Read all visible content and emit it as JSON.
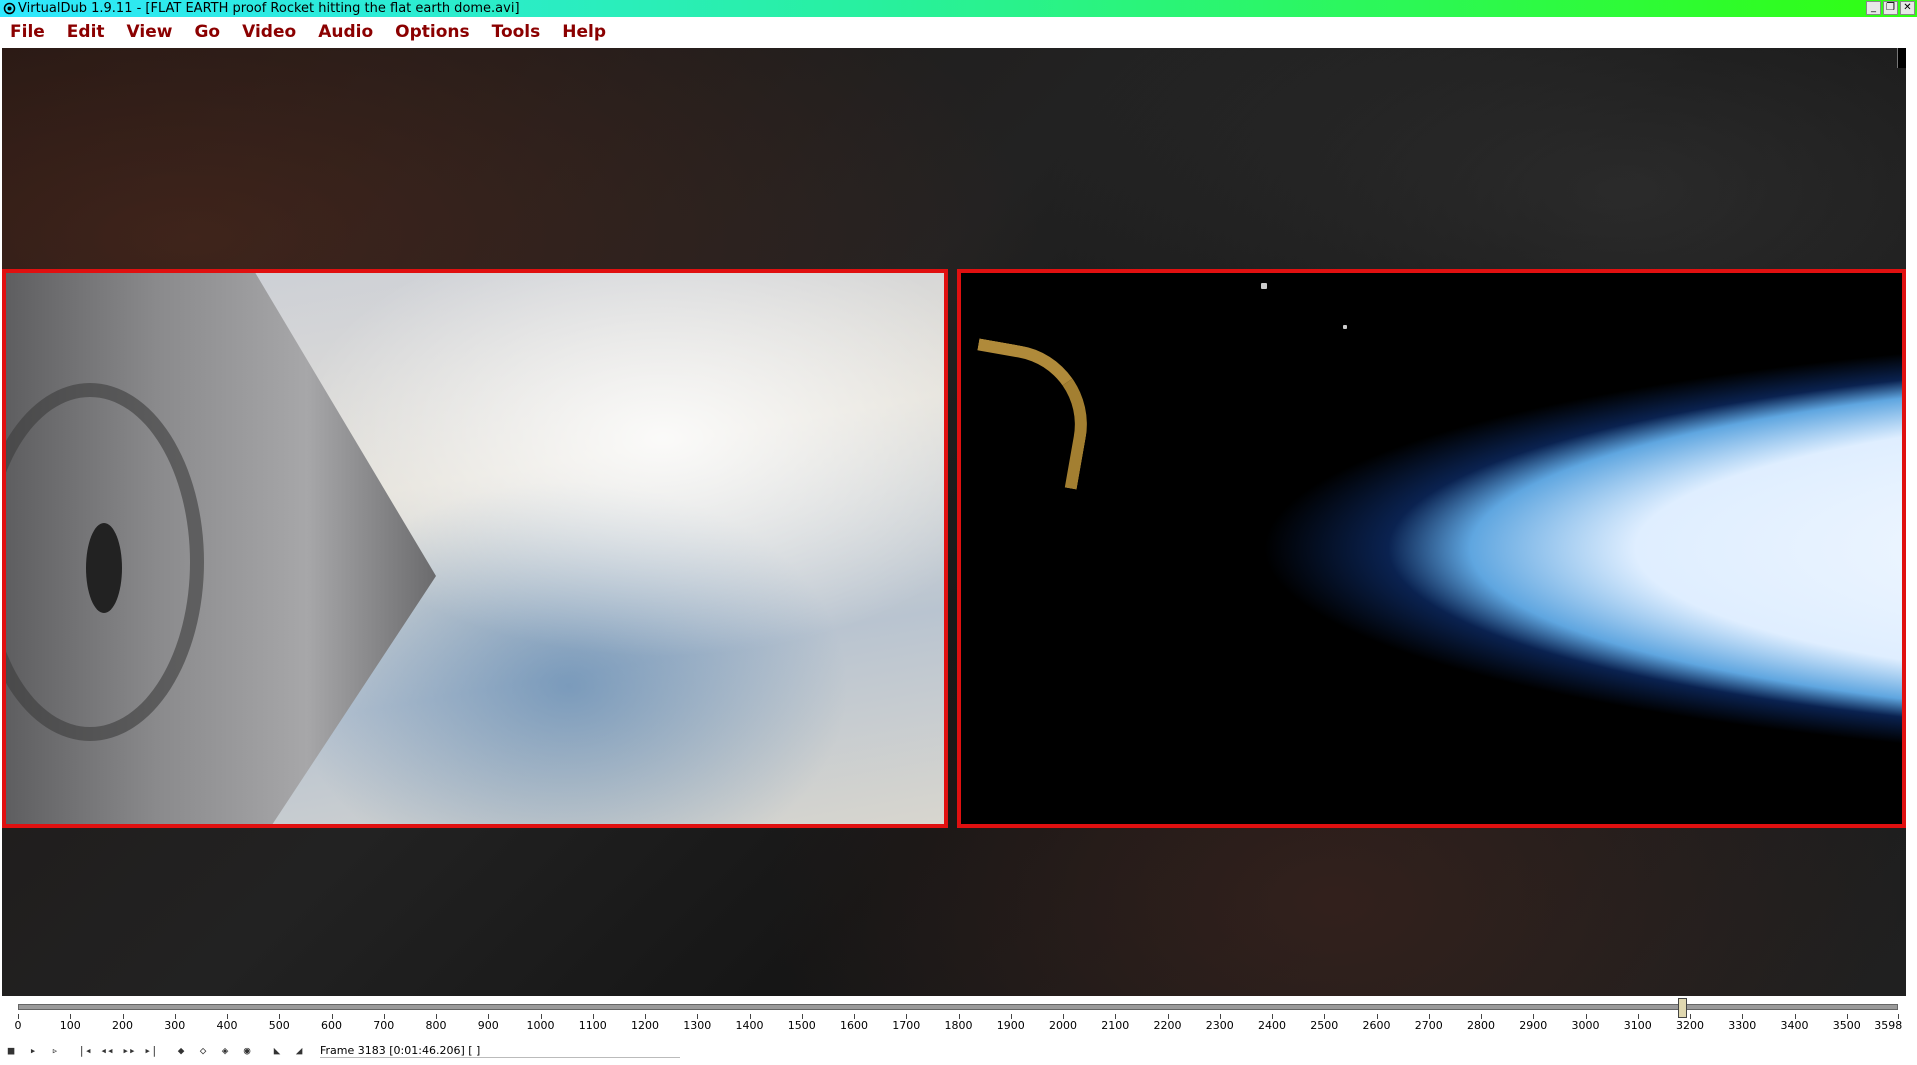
{
  "window": {
    "title": "VirtualDub 1.9.11 - [FLAT EARTH proof Rocket hitting the flat earth dome.avi]",
    "controls": [
      "_",
      "❐",
      "✕"
    ]
  },
  "menu": [
    {
      "label": "File"
    },
    {
      "label": "Edit"
    },
    {
      "label": "View"
    },
    {
      "label": "Go"
    },
    {
      "label": "Video"
    },
    {
      "label": "Audio"
    },
    {
      "label": "Options"
    },
    {
      "label": "Tools"
    },
    {
      "label": "Help"
    }
  ],
  "timeline": {
    "min": 0,
    "max": 3598,
    "current_frame": 3183,
    "ticks": [
      "0",
      "100",
      "200",
      "300",
      "400",
      "500",
      "600",
      "700",
      "800",
      "900",
      "1000",
      "1100",
      "1200",
      "1300",
      "1400",
      "1500",
      "1600",
      "1700",
      "1800",
      "1900",
      "2000",
      "2100",
      "2200",
      "2300",
      "2400",
      "2500",
      "2600",
      "2700",
      "2800",
      "2900",
      "3000",
      "3100",
      "3200",
      "3300",
      "3400",
      "3500",
      "3598"
    ]
  },
  "toolbar": {
    "buttons": [
      {
        "icon": "stop-icon",
        "glyph": "■"
      },
      {
        "icon": "play-input-icon",
        "glyph": "▸"
      },
      {
        "icon": "play-output-icon",
        "glyph": "▹"
      },
      {
        "icon": "go-start-icon",
        "glyph": "|◂"
      },
      {
        "icon": "step-back-icon",
        "glyph": "◂◂"
      },
      {
        "icon": "step-forward-icon",
        "glyph": "▸▸"
      },
      {
        "icon": "go-end-icon",
        "glyph": "▸|"
      },
      {
        "icon": "prev-keyframe-icon",
        "glyph": "◆"
      },
      {
        "icon": "next-keyframe-icon",
        "glyph": "◇"
      },
      {
        "icon": "prev-scene-icon",
        "glyph": "◈"
      },
      {
        "icon": "next-scene-icon",
        "glyph": "◉"
      },
      {
        "icon": "mark-in-icon",
        "glyph": "◣"
      },
      {
        "icon": "mark-out-icon",
        "glyph": "◢"
      }
    ],
    "status": "Frame 3183 [0:01:46.206] [ ]"
  }
}
